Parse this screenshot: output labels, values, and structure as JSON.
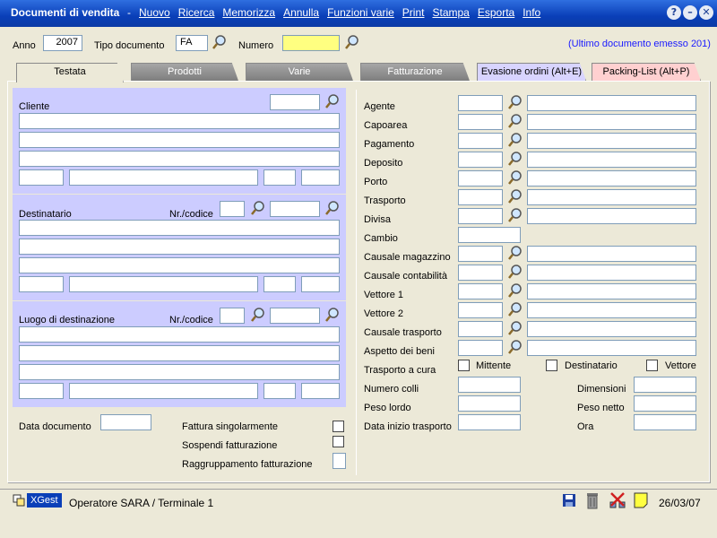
{
  "window": {
    "title": "Documenti di vendita",
    "menu": [
      "Nuovo",
      "Ricerca",
      "Memorizza",
      "Annulla",
      "Funzioni varie",
      "Print",
      "Stampa",
      "Esporta",
      "Info"
    ],
    "help": "?",
    "minimize": "–",
    "close": "✕"
  },
  "header": {
    "anno_label": "Anno",
    "anno_value": "2007",
    "tipo_label": "Tipo documento",
    "tipo_value": "FA",
    "numero_label": "Numero",
    "numero_value": "",
    "last_doc": "(Ultimo documento emesso 201)"
  },
  "tabs": [
    {
      "label": "Testata"
    },
    {
      "label": "Prodotti"
    },
    {
      "label": "Varie"
    },
    {
      "label": "Fatturazione"
    },
    {
      "label": "Evasione ordini (Alt+E)"
    },
    {
      "label": "Packing-List (Alt+P)"
    }
  ],
  "left": {
    "cliente": "Cliente",
    "destinatario": "Destinatario",
    "nr_codice": "Nr./codice",
    "luogo": "Luogo di destinazione",
    "data_documento": "Data documento",
    "fattura_singolarmente": "Fattura singolarmente",
    "sospendi_fatturazione": "Sospendi fatturazione",
    "raggruppamento_fatturazione": "Raggruppamento fatturazione"
  },
  "right": {
    "agente": "Agente",
    "capoarea": "Capoarea",
    "pagamento": "Pagamento",
    "deposito": "Deposito",
    "porto": "Porto",
    "trasporto": "Trasporto",
    "divisa": "Divisa",
    "cambio": "Cambio",
    "causale_magazzino": "Causale magazzino",
    "causale_contabilita": "Causale contabilità",
    "vettore1": "Vettore 1",
    "vettore2": "Vettore 2",
    "causale_trasporto": "Causale trasporto",
    "aspetto_beni": "Aspetto dei beni",
    "trasporto_cura": "Trasporto a cura",
    "mittente": "Mittente",
    "destinatario": "Destinatario",
    "vettore": "Vettore",
    "numero_colli": "Numero colli",
    "dimensioni": "Dimensioni",
    "peso_lordo": "Peso lordo",
    "peso_netto": "Peso netto",
    "data_inizio_trasporto": "Data inizio trasporto",
    "ora": "Ora"
  },
  "status": {
    "app": "XGest",
    "operator": "Operatore SARA / Terminale 1",
    "date": "26/03/07"
  },
  "colors": {
    "titlebar": "#0a3fb8",
    "section": "#ccccff",
    "numero_field": "#ffff80",
    "tab_evasione": "#d8d4ff",
    "tab_packing": "#ffd0d0"
  }
}
